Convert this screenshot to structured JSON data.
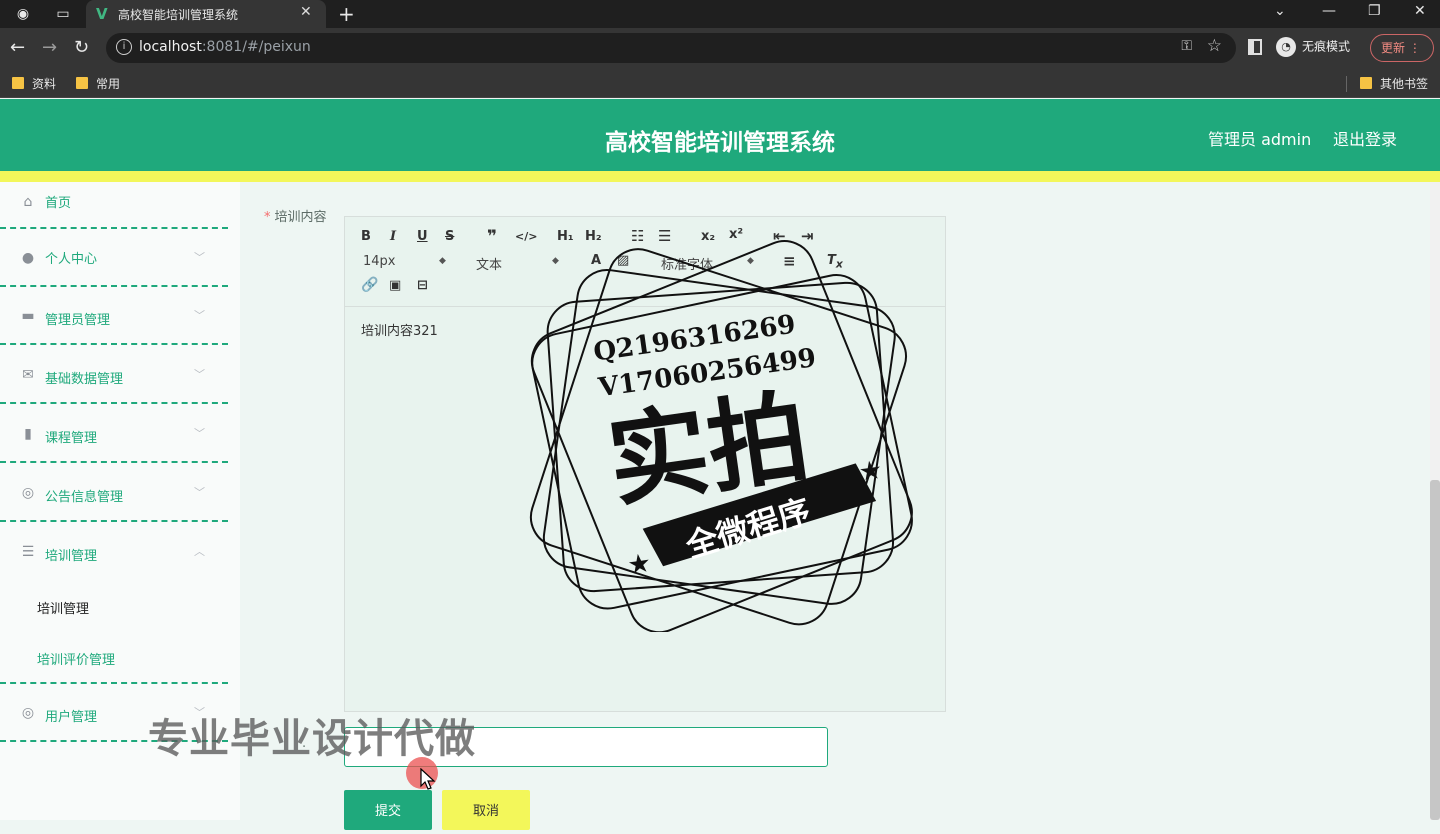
{
  "browser": {
    "tab_title": "高校智能培训管理系统",
    "url_host": "localhost",
    "url_rest": ":8081/#/peixun",
    "incognito_label": "无痕模式",
    "update_label": "更新",
    "bookmarks": [
      "资料",
      "常用"
    ],
    "other_bookmarks": "其他书签"
  },
  "header": {
    "title": "高校智能培训管理系统",
    "admin_label": "管理员 admin",
    "logout_label": "退出登录"
  },
  "sidebar": {
    "items": [
      {
        "label": "首页",
        "icon": "home-icon"
      },
      {
        "label": "个人中心",
        "icon": "user-icon"
      },
      {
        "label": "管理员管理",
        "icon": "monitor-icon"
      },
      {
        "label": "基础数据管理",
        "icon": "mail-icon"
      },
      {
        "label": "课程管理",
        "icon": "bar-chart-icon"
      },
      {
        "label": "公告信息管理",
        "icon": "compass-icon"
      },
      {
        "label": "培训管理",
        "icon": "list-icon"
      },
      {
        "label": "用户管理",
        "icon": "user-circle-icon"
      }
    ],
    "submenu": [
      "培训管理",
      "培训评价管理"
    ]
  },
  "form": {
    "content_label": "培训内容",
    "content_value": "培训内容321",
    "font_size": "14px",
    "text_type": "文本",
    "font_family": "标准字体",
    "submit_label": "提交",
    "cancel_label": "取消"
  },
  "watermark": {
    "qq": "Q2196316269",
    "wechat": "V17060256499",
    "big_text": "实拍",
    "banner": "全微程序",
    "overlay": "专业毕业设计代做"
  },
  "colors": {
    "accent": "#1fa97c",
    "yellow": "#f3f75a"
  }
}
